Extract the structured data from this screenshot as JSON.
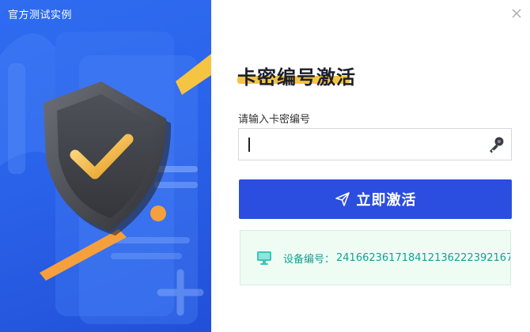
{
  "window": {
    "title": "官方测试实例"
  },
  "header": {
    "title": "卡密编号激活"
  },
  "form": {
    "label": "请输入卡密编号",
    "value": "",
    "placeholder": ""
  },
  "actions": {
    "activate_label": "立即激活"
  },
  "device": {
    "label": "设备编号：",
    "id": "241662361718412136222392167"
  },
  "icons": {
    "close": "close-icon",
    "key": "key-icon",
    "send": "send-icon",
    "monitor": "monitor-icon",
    "shield": "shield-check-icon"
  },
  "colors": {
    "panel_blue": "#2a63ea",
    "button_blue": "#2b4de0",
    "accent_yellow": "#f6c443",
    "accent_orange": "#f5a03c",
    "device_text": "#1a9e92",
    "device_bg": "#eefcf4"
  }
}
